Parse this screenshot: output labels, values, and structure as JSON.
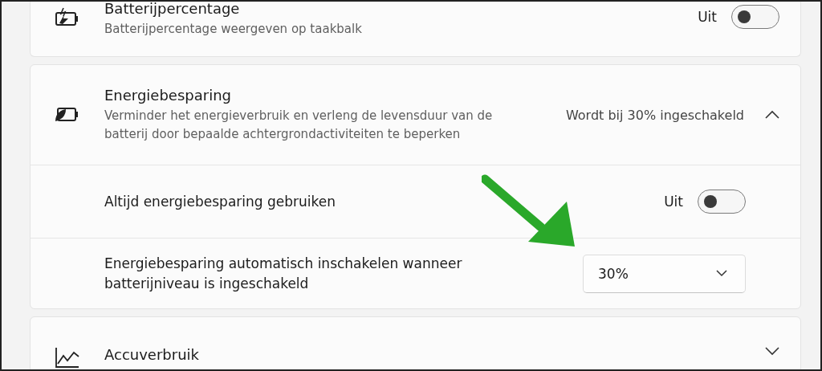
{
  "battery_percentage": {
    "title": "Batterijpercentage",
    "description": "Batterijpercentage weergeven op taakbalk",
    "state_label": "Uit",
    "checked": false
  },
  "energy_saver": {
    "title": "Energiebesparing",
    "description": "Verminder het energieverbruik en verleng de levensduur van de batterij door bepaalde achtergrondactiviteiten te beperken",
    "status": "Wordt bij 30% ingeschakeld",
    "expanded": true,
    "options": [
      {
        "kind": "toggle",
        "label": "Altijd energiebesparing gebruiken",
        "state_label": "Uit",
        "checked": false
      },
      {
        "kind": "dropdown",
        "label": "Energiebesparing automatisch inschakelen wanneer batterijniveau is ingeschakeld",
        "value": "30%"
      }
    ]
  },
  "battery_usage": {
    "title": "Accuverbruik",
    "expanded": false
  }
}
